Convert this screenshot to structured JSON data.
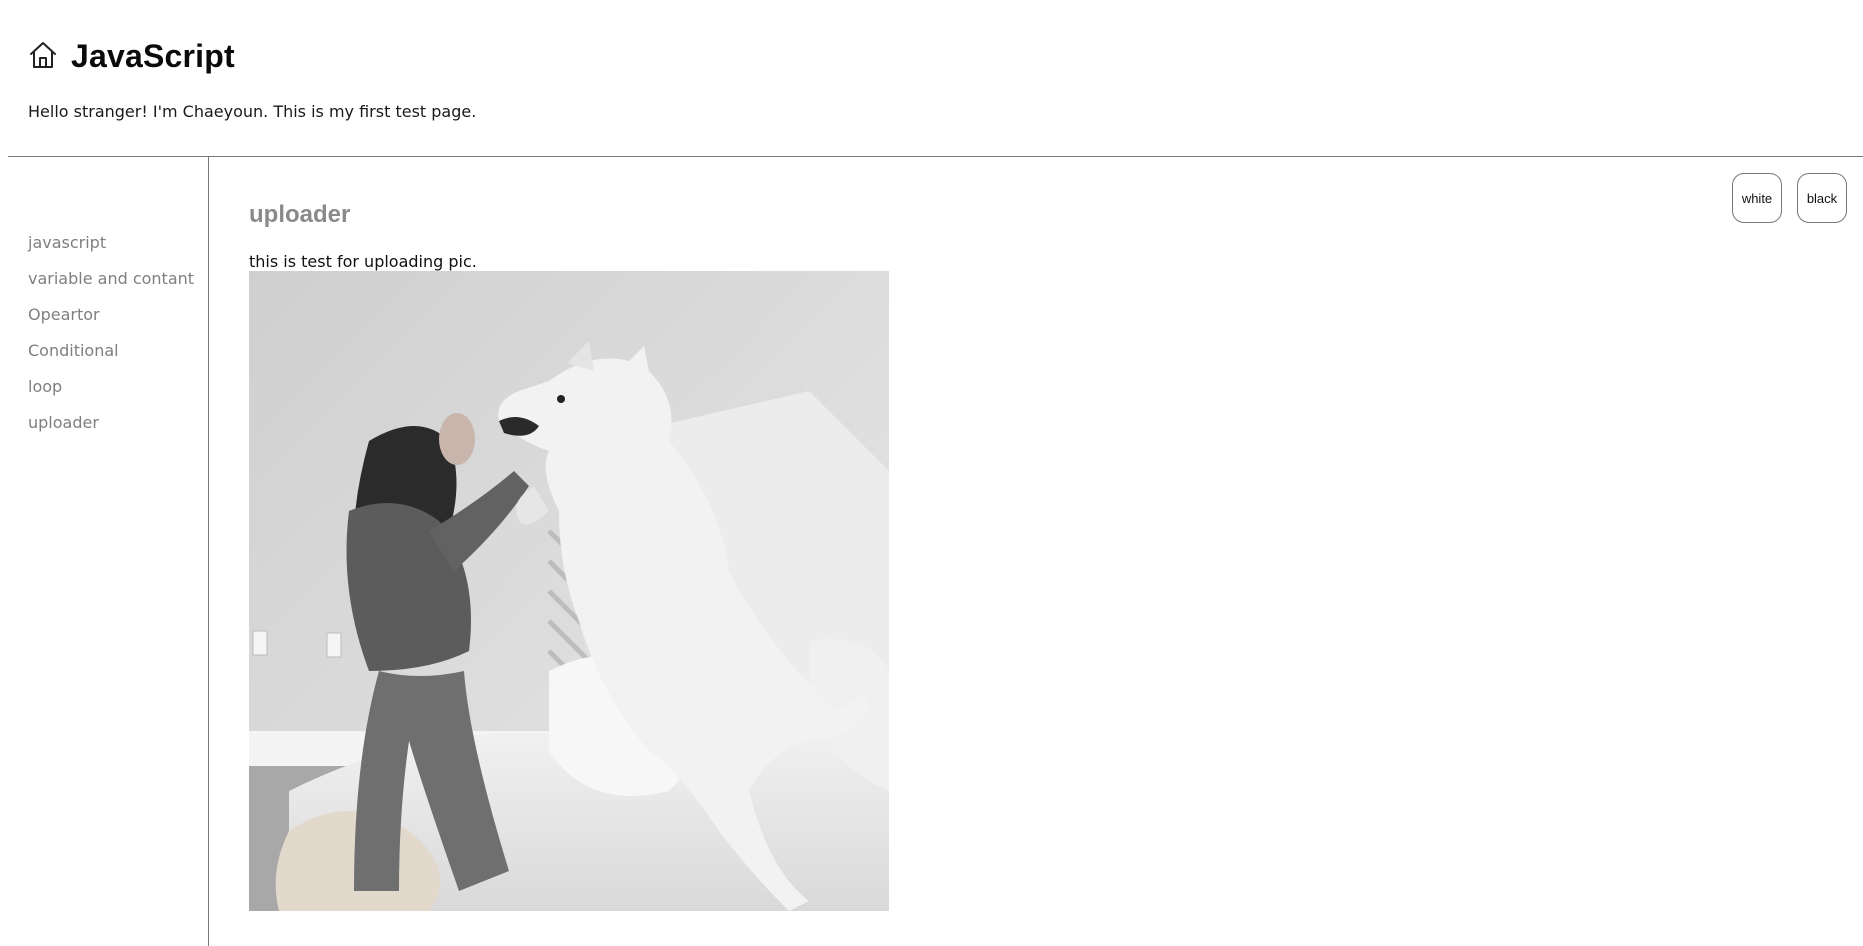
{
  "header": {
    "home_icon": "home-icon",
    "title": "JavaScript",
    "description": "Hello stranger! I'm Chaeyoun. This is my first test page."
  },
  "sidebar": {
    "items": [
      {
        "label": "javascript"
      },
      {
        "label": "variable and contant"
      },
      {
        "label": "Opeartor"
      },
      {
        "label": "Conditional"
      },
      {
        "label": "loop"
      },
      {
        "label": "uploader"
      }
    ]
  },
  "main": {
    "title": "uploader",
    "text": "this is test for uploading pic.",
    "image_alt": "photo of a woman playing with a white dog on a bed"
  },
  "theme_buttons": {
    "white_label": "white",
    "black_label": "black"
  },
  "colors": {
    "title_text": "#0a0a0a",
    "nav_text": "#7f7f7f",
    "article_title": "#8a8a8a",
    "divider": "#7a7a7a"
  }
}
